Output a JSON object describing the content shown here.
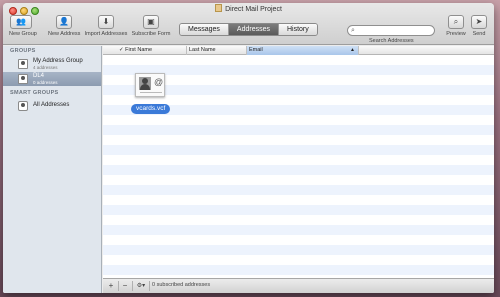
{
  "window": {
    "title": "Direct Mail Project"
  },
  "toolbar": {
    "new_group": "New Group",
    "new_address": "New Address",
    "import_addresses": "Import Addresses",
    "subscribe_form": "Subscribe Form",
    "tabs": [
      "Messages",
      "Addresses",
      "History"
    ],
    "active_tab": "Addresses",
    "search_placeholder": "",
    "search_label": "Search Addresses",
    "preview": "Preview",
    "send": "Send"
  },
  "sidebar": {
    "groups_header": "GROUPS",
    "groups": [
      {
        "name": "My Address Group",
        "count": "4 addresses"
      },
      {
        "name": "DL4",
        "count": "0 addresses"
      }
    ],
    "smart_groups_header": "SMART GROUPS",
    "smart_groups": [
      {
        "name": "All Addresses"
      }
    ]
  },
  "table": {
    "check_col": "✓",
    "columns": [
      "First Name",
      "Last Name",
      "Email"
    ],
    "sorted_column": "Email",
    "sort_indicator": "▲"
  },
  "drag_item": {
    "label": "vcards.vcf",
    "icon": "vcard-file-icon"
  },
  "footer": {
    "add": "+",
    "remove": "−",
    "action": "⚙▾",
    "status": "0 subscribed addresses"
  },
  "colors": {
    "accent": "#3b7ad8",
    "sidebar_bg": "#e0e6ed",
    "stripe": "#edf3fd"
  }
}
